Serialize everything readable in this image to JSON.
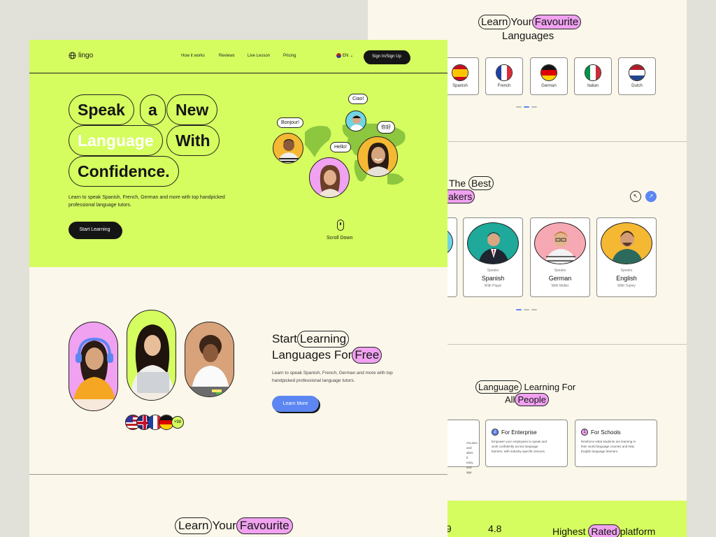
{
  "back": {
    "languages_title": [
      "Learn",
      "Your",
      "Favourite",
      "Languages"
    ],
    "languages": [
      "Spanish",
      "French",
      "German",
      "Italian",
      "Dutch"
    ],
    "speakers_title_a": [
      "The",
      "Best"
    ],
    "speakers_title_b": "akers",
    "tutors": [
      {
        "speaks": "Speaks",
        "language": "Spanish",
        "with": "With Piqué"
      },
      {
        "speaks": "Speaks",
        "language": "German",
        "with": "With Müller"
      },
      {
        "speaks": "Speaks",
        "language": "English",
        "with": "With Topley"
      }
    ],
    "audience_title": [
      "Language",
      "Learning For",
      "All",
      "People"
    ],
    "audience_cards": [
      {
        "num": "",
        "title": "",
        "desc": "rriculum and\nakes it easy and\nage."
      },
      {
        "num": "2",
        "title": "For Enterprise",
        "desc": "Empower your employees to speak and\nwork confidently across language\nbarriers, with industry-specific lessons."
      },
      {
        "num": "1",
        "title": "For Schools",
        "desc": "Reinforce what students are learning in\ntheir world language courses and help\nEnglish language learners."
      }
    ],
    "stat1": ".9",
    "stat2": "4.8",
    "rated_title": [
      "Highest",
      "Rated",
      "platform"
    ]
  },
  "front": {
    "logo": "lingo",
    "nav": [
      "How it works",
      "Reviews",
      "Live Lesson",
      "Pricing"
    ],
    "lang": "EN",
    "signin": "Sign In/Sign Up",
    "hero_words": [
      "Speak",
      "a",
      "New",
      "Language",
      "With",
      "Confidence."
    ],
    "hero_desc": "Learn to speak Spanish, French, German and more with top handpicked professional language tutors.",
    "hero_cta": "Start Learning",
    "bubbles": [
      "Ciao!",
      "Bonjour!",
      "你好",
      "Hello!"
    ],
    "scroll": "Scroll Down",
    "free_title": [
      "Start",
      "Learning",
      "Languages For",
      "Free"
    ],
    "free_desc": "Learn to speak Spanish, French, German and more with top handpicked professional language tutors.",
    "free_cta": "Learn More",
    "more_flags": "+98",
    "bottom_title": [
      "Learn",
      "Your",
      "Favourite"
    ]
  },
  "colors": {
    "lime": "#d5fd5f",
    "pink": "#f0a2f0",
    "blue": "#5c86f2",
    "cream": "#fbf7ea",
    "dark": "#151515"
  }
}
